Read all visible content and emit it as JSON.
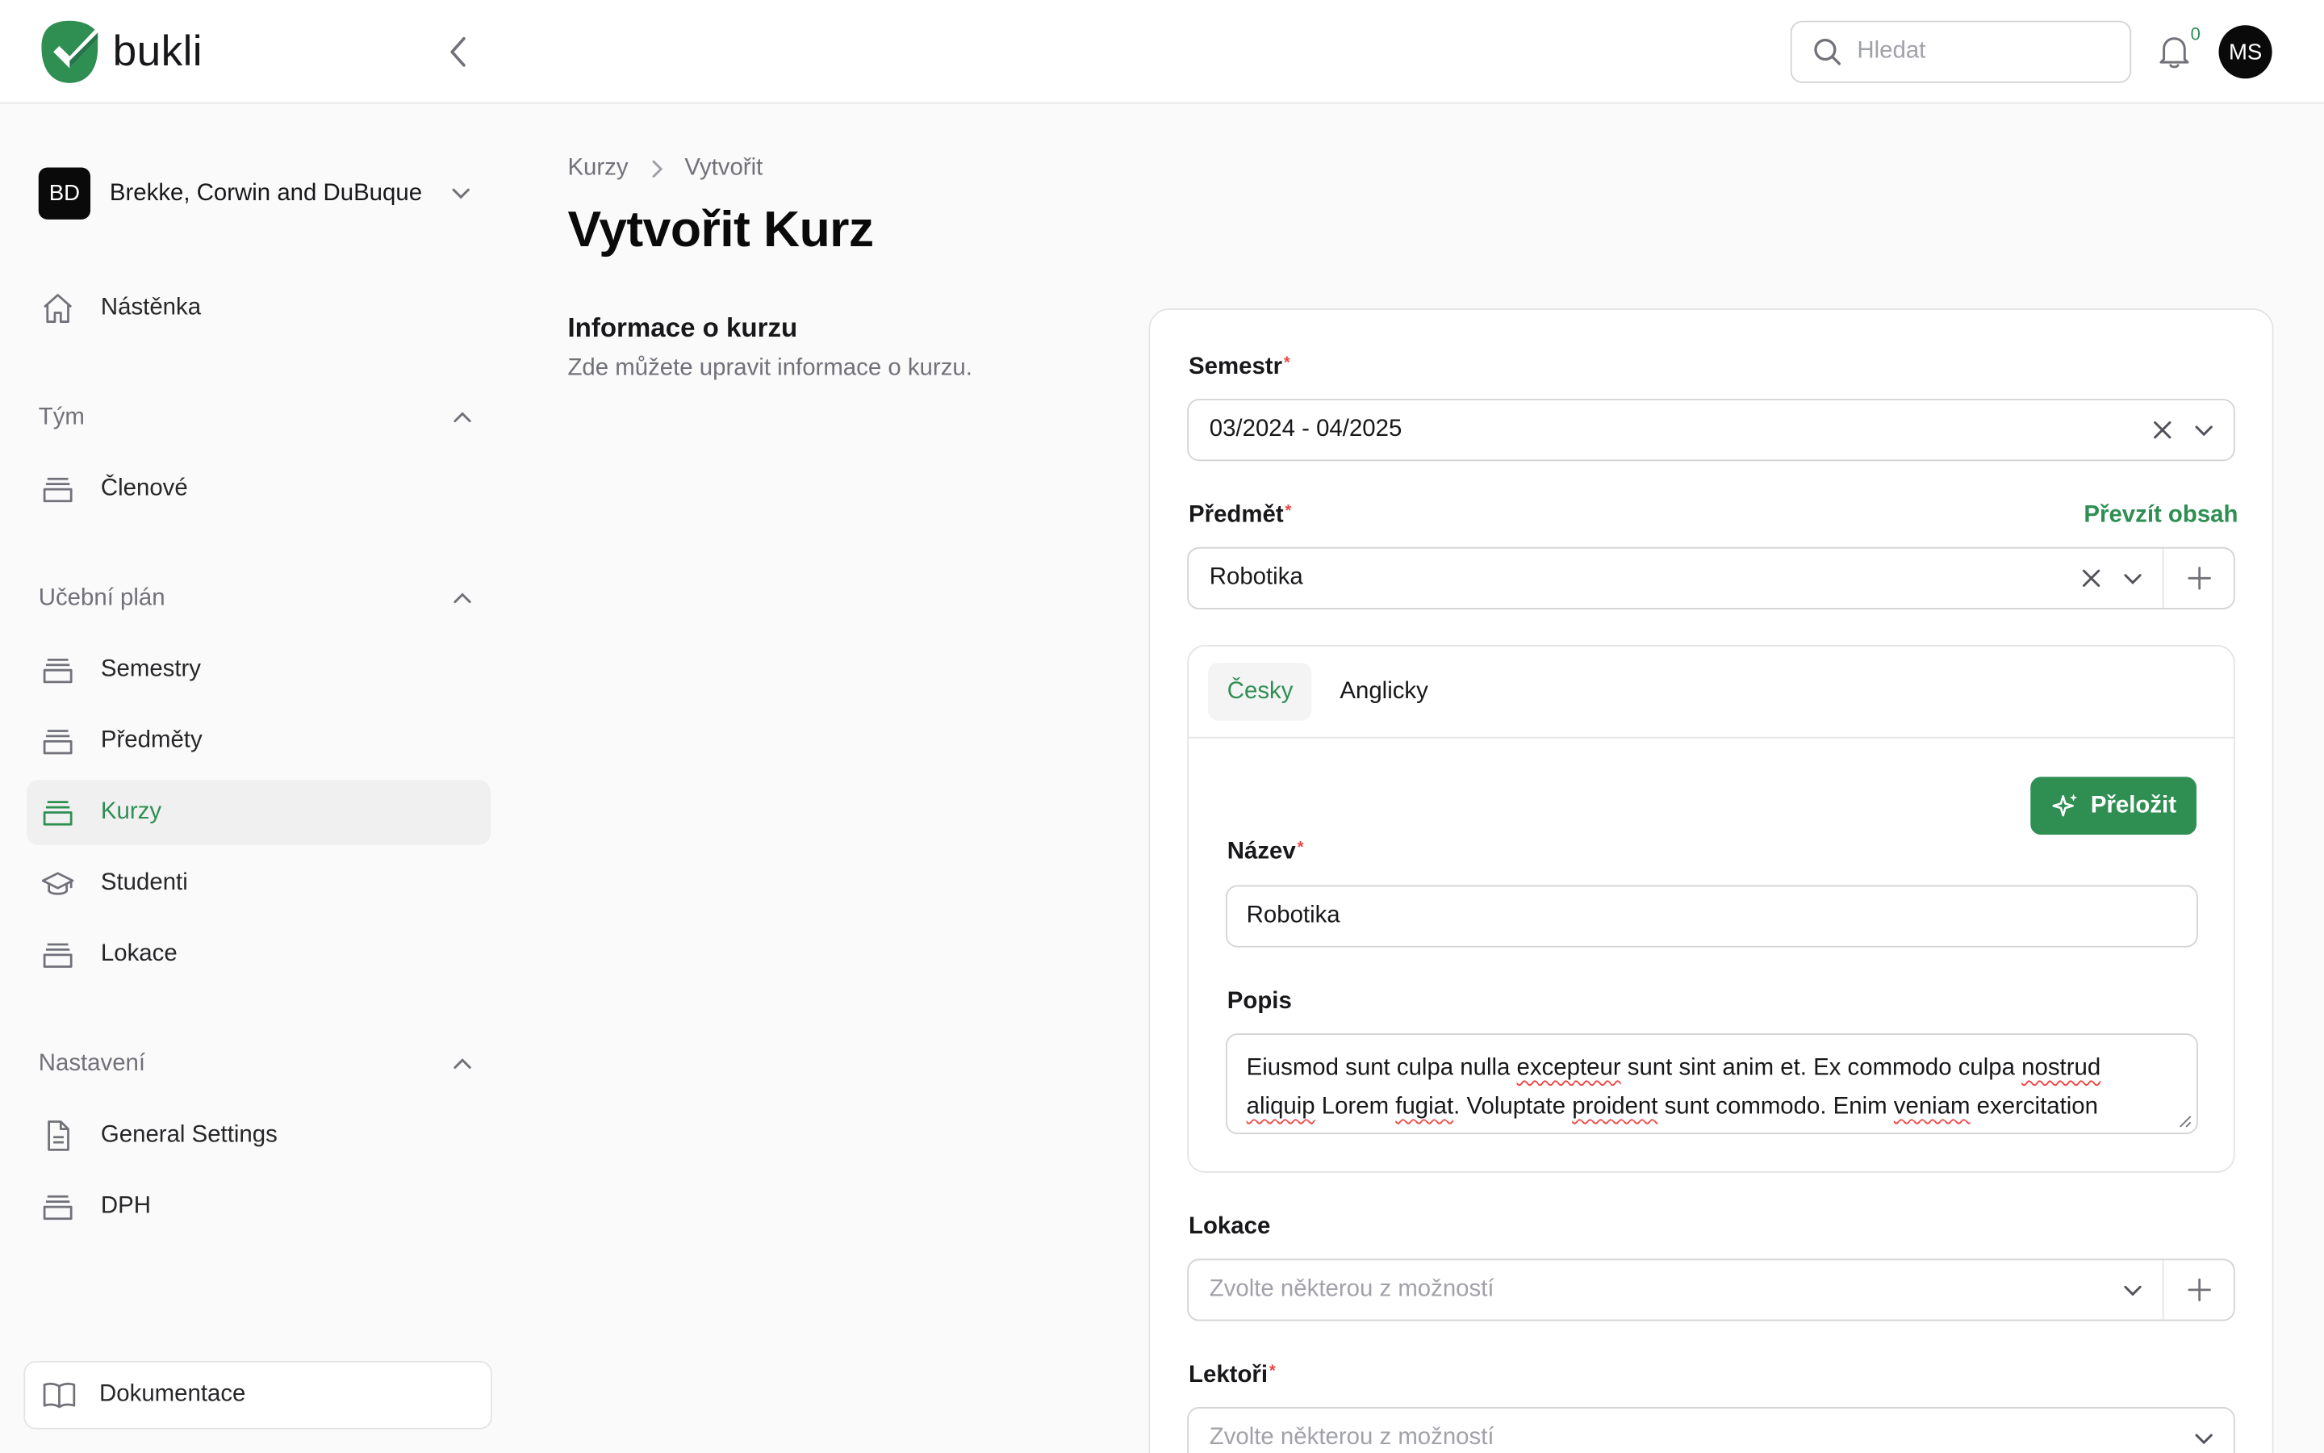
{
  "app": {
    "name": "bukli"
  },
  "header": {
    "search_placeholder": "Hledat",
    "notifications_count": "0",
    "user_initials": "MS"
  },
  "sidebar": {
    "team": {
      "initials": "BD",
      "name": "Brekke, Corwin and DuBuque"
    },
    "dashboard": "Nástěnka",
    "groups": [
      {
        "label": "Tým",
        "items": [
          {
            "label": "Členové",
            "icon": "archive-icon"
          }
        ]
      },
      {
        "label": "Učební plán",
        "items": [
          {
            "label": "Semestry",
            "icon": "archive-icon"
          },
          {
            "label": "Předměty",
            "icon": "archive-icon"
          },
          {
            "label": "Kurzy",
            "icon": "archive-icon",
            "active": true
          },
          {
            "label": "Studenti",
            "icon": "graduation-cap-icon"
          },
          {
            "label": "Lokace",
            "icon": "archive-icon"
          }
        ]
      },
      {
        "label": "Nastavení",
        "items": [
          {
            "label": "General Settings",
            "icon": "document-icon"
          },
          {
            "label": "DPH",
            "icon": "archive-icon"
          }
        ]
      }
    ],
    "documentation": "Dokumentace"
  },
  "breadcrumb": {
    "parent": "Kurzy",
    "current": "Vytvořit"
  },
  "page": {
    "title": "Vytvořit Kurz",
    "section_title": "Informace o kurzu",
    "section_desc": "Zde můžete upravit informace o kurzu."
  },
  "form": {
    "semester": {
      "label": "Semestr",
      "value": "03/2024 - 04/2025"
    },
    "subject": {
      "label": "Předmět",
      "value": "Robotika",
      "action": "Převzít obsah"
    },
    "tabs": [
      "Česky",
      "Anglicky"
    ],
    "translate_label": "Přeložit",
    "name": {
      "label": "Název",
      "value": "Robotika"
    },
    "description": {
      "label": "Popis",
      "line1": [
        "Eiusmod sunt culpa nulla ",
        "excepteur",
        " sunt sint anim et. Ex commodo culpa ",
        "nostrud"
      ],
      "line2": [
        "aliquip",
        " Lorem ",
        "fugiat",
        ". Voluptate ",
        "proident",
        " sunt commodo. Enim ",
        "veniam",
        " exercitation"
      ]
    },
    "location": {
      "label": "Lokace",
      "placeholder": "Zvolte některou z možností"
    },
    "lecturers": {
      "label": "Lektoři",
      "placeholder": "Zvolte některou z možností"
    }
  },
  "colors": {
    "accent": "#2f8f53",
    "required": "#ef4444",
    "dark": "#0a0a0a"
  }
}
